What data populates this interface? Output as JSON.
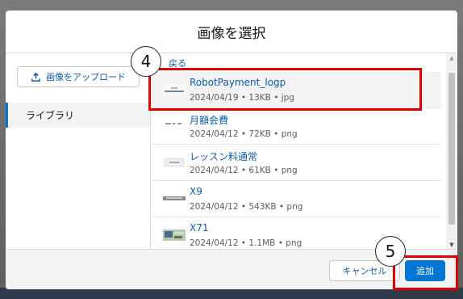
{
  "dialog": {
    "title": "画像を選択",
    "upload_label": "画像をアップロード",
    "sidebar_item": "ライブラリ",
    "back_label": "戻る",
    "cancel_label": "キャンセル",
    "add_label": "追加"
  },
  "files": [
    {
      "name": "RobotPayment_logp",
      "date": "2024/04/19",
      "size": "13KB",
      "type": "jpg",
      "selected": true
    },
    {
      "name": "月額会費",
      "date": "2024/04/12",
      "size": "72KB",
      "type": "png"
    },
    {
      "name": "レッスン料通常",
      "date": "2024/04/12",
      "size": "61KB",
      "type": "png"
    },
    {
      "name": "X9",
      "date": "2024/04/12",
      "size": "543KB",
      "type": "png"
    },
    {
      "name": "X71",
      "date": "2024/04/12",
      "size": "1.1MB",
      "type": "png"
    }
  ],
  "annotations": [
    {
      "number": "4"
    },
    {
      "number": "5"
    }
  ],
  "colors": {
    "accent": "#0176d3",
    "link": "#0b5cab",
    "highlight": "#e00000"
  }
}
